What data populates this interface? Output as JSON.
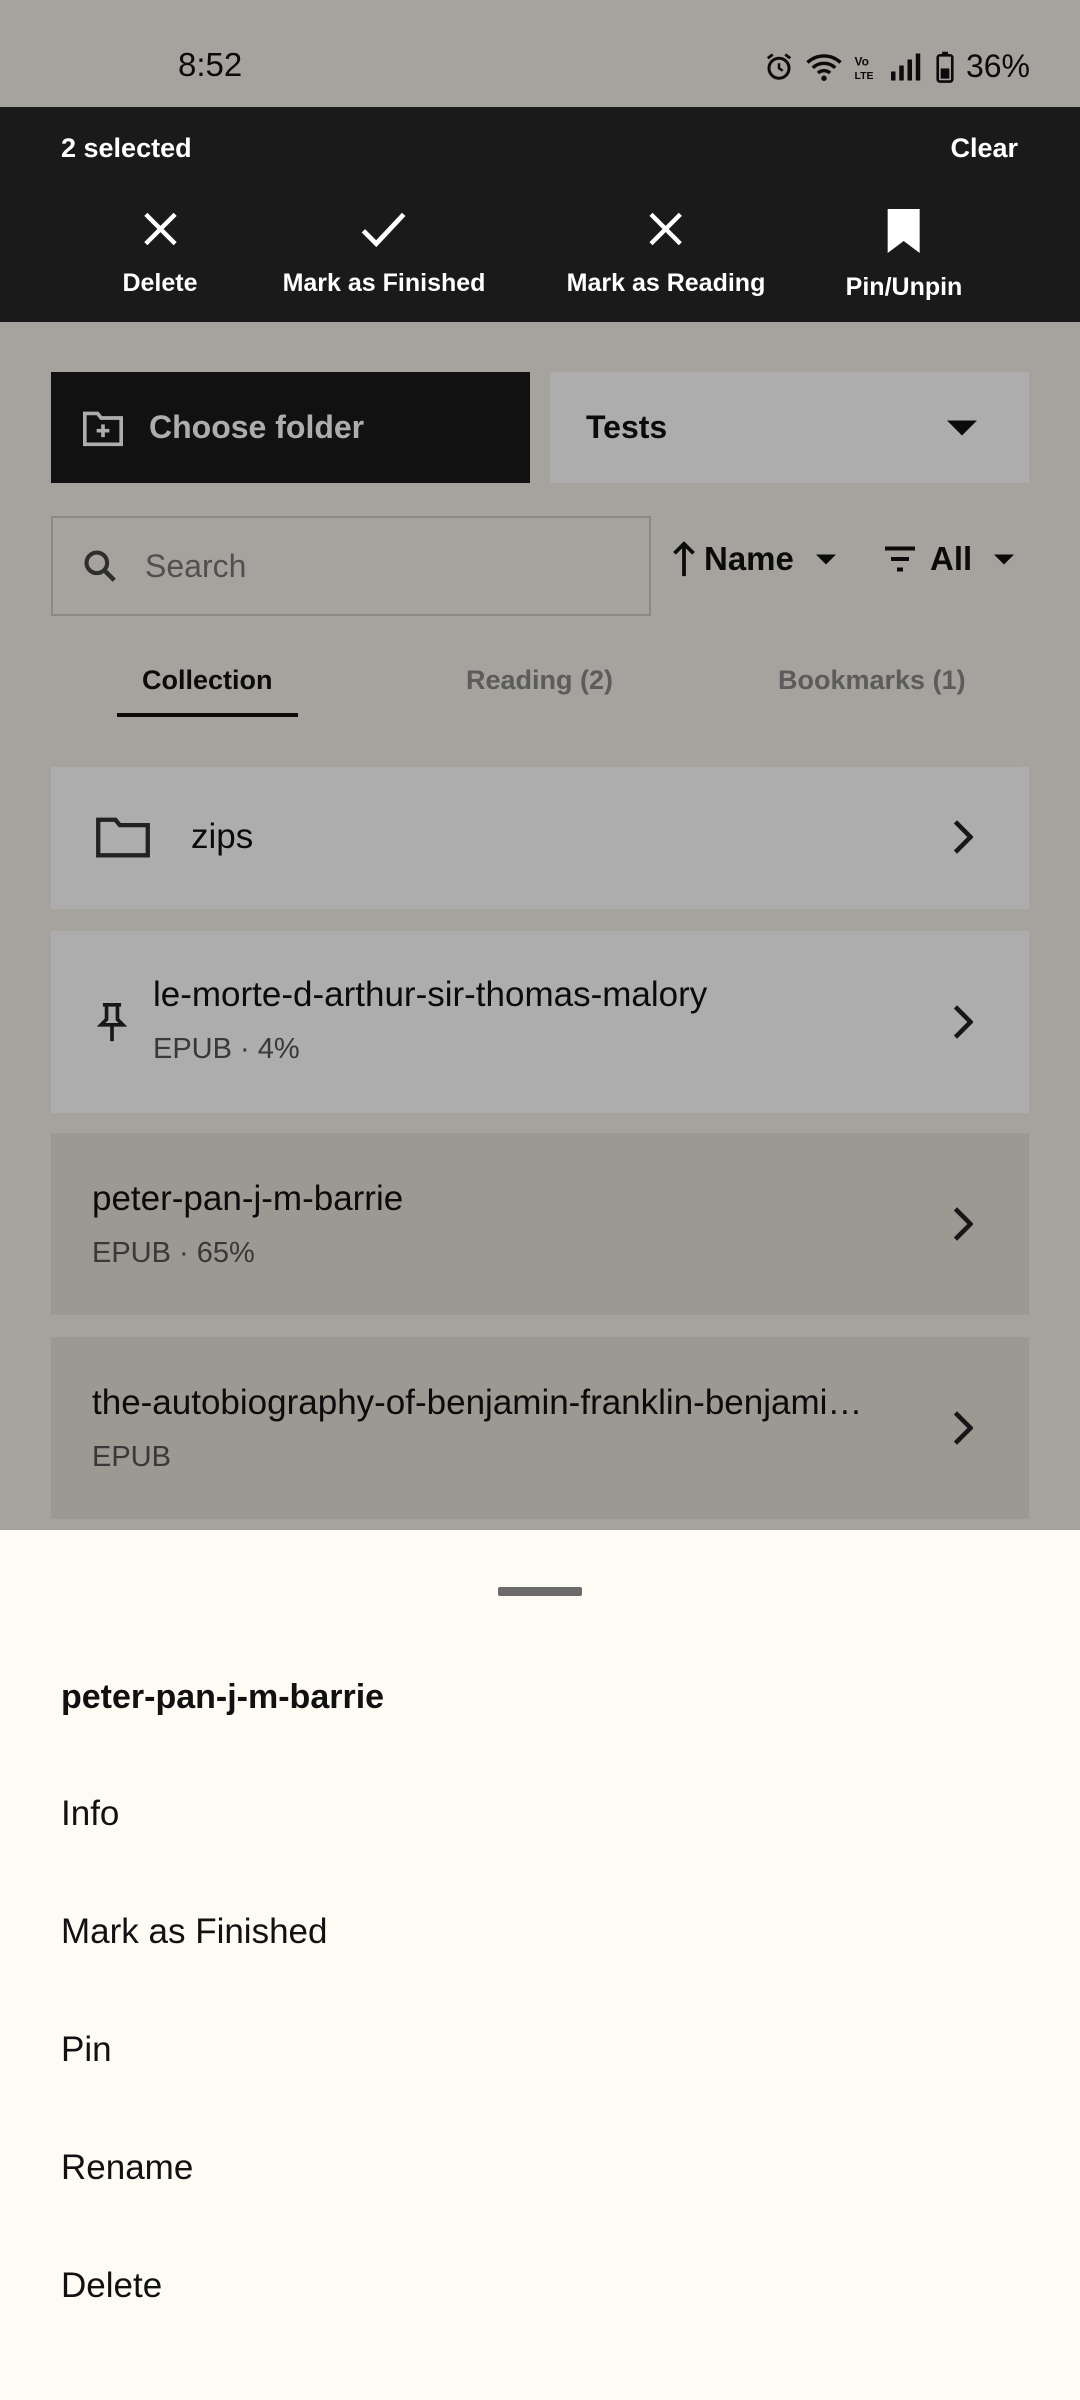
{
  "status_bar": {
    "time": "8:52",
    "battery": "36%"
  },
  "selection_bar": {
    "count_label": "2 selected",
    "clear_label": "Clear",
    "actions": [
      {
        "label": "Delete",
        "icon": "close-icon"
      },
      {
        "label": "Mark as Finished",
        "icon": "check-icon"
      },
      {
        "label": "Mark as Reading",
        "icon": "close-icon"
      },
      {
        "label": "Pin/Unpin",
        "icon": "bookmark-icon"
      }
    ]
  },
  "toolbar": {
    "choose_folder_label": "Choose folder",
    "folder_selected": "Tests",
    "search_placeholder": "Search",
    "sort_label": "Name",
    "filter_label": "All"
  },
  "tabs": [
    {
      "label": "Collection",
      "active": true
    },
    {
      "label": "Reading (2)",
      "active": false
    },
    {
      "label": "Bookmarks (1)",
      "active": false
    }
  ],
  "library": [
    {
      "type": "folder",
      "title": "zips"
    },
    {
      "type": "book",
      "title": "le-morte-d-arthur-sir-thomas-malory",
      "subtitle": "EPUB · 4%",
      "pinned": true,
      "selected": false
    },
    {
      "type": "book",
      "title": "peter-pan-j-m-barrie",
      "subtitle": "EPUB · 65%",
      "pinned": false,
      "selected": true
    },
    {
      "type": "book",
      "title": "the-autobiography-of-benjamin-franklin-benjami…",
      "subtitle": "EPUB",
      "pinned": false,
      "selected": true
    }
  ],
  "sheet": {
    "title": "peter-pan-j-m-barrie",
    "items": [
      "Info",
      "Mark as Finished",
      "Pin",
      "Rename",
      "Delete"
    ]
  }
}
